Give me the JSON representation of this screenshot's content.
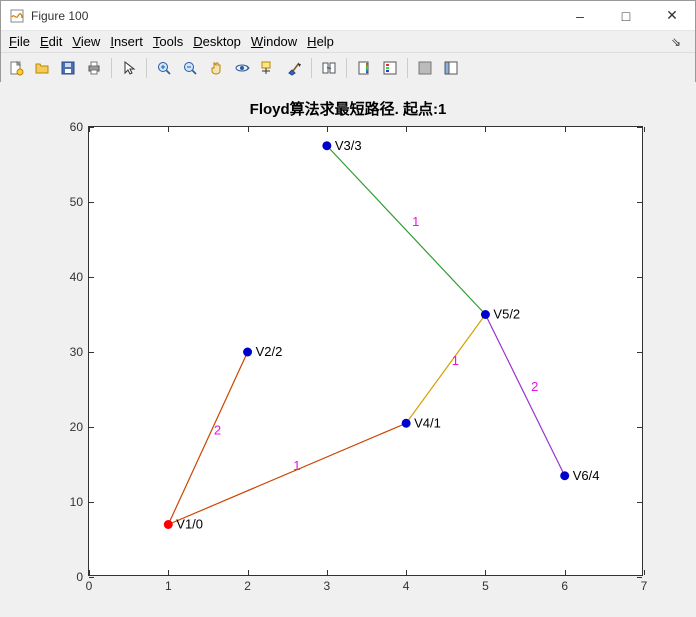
{
  "window": {
    "title": "Figure 100"
  },
  "menu": {
    "file": "File",
    "edit": "Edit",
    "view": "View",
    "insert": "Insert",
    "tools": "Tools",
    "desktop": "Desktop",
    "window": "Window",
    "help": "Help"
  },
  "toolbar_icons": {
    "new": "new-file-icon",
    "open": "open-folder-icon",
    "save": "save-icon",
    "print": "print-icon",
    "pointer": "pointer-icon",
    "zoom_in": "zoom-in-icon",
    "zoom_out": "zoom-out-icon",
    "pan": "pan-icon",
    "rotate": "rotate-3d-icon",
    "datatip": "data-cursor-icon",
    "brush": "brush-icon",
    "link": "link-plot-icon",
    "colorbar": "colorbar-icon",
    "legend": "legend-icon",
    "hide": "hide-plot-icon",
    "dock": "dock-icon"
  },
  "chart_data": {
    "type": "scatter",
    "title": "Floyd算法求最短路径. 起点:1",
    "xlim": [
      0,
      7
    ],
    "ylim": [
      0,
      60
    ],
    "xticks": [
      0,
      1,
      2,
      3,
      4,
      5,
      6,
      7
    ],
    "yticks": [
      0,
      10,
      20,
      30,
      40,
      50,
      60
    ],
    "nodes": [
      {
        "id": "V1",
        "x": 1,
        "y": 7,
        "label": "V1/0",
        "color": "#ff0000"
      },
      {
        "id": "V2",
        "x": 2,
        "y": 30,
        "label": "V2/2",
        "color": "#0000cc"
      },
      {
        "id": "V3",
        "x": 3,
        "y": 57.5,
        "label": "V3/3",
        "color": "#0000cc"
      },
      {
        "id": "V4",
        "x": 4,
        "y": 20.5,
        "label": "V4/1",
        "color": "#0000cc"
      },
      {
        "id": "V5",
        "x": 5,
        "y": 35,
        "label": "V5/2",
        "color": "#0000cc"
      },
      {
        "id": "V6",
        "x": 6,
        "y": 13.5,
        "label": "V6/4",
        "color": "#0000cc"
      }
    ],
    "edges": [
      {
        "from": "V1",
        "to": "V2",
        "weight": "2",
        "color": "#cc4400"
      },
      {
        "from": "V1",
        "to": "V4",
        "weight": "1",
        "color": "#cc4400"
      },
      {
        "from": "V4",
        "to": "V5",
        "weight": "1",
        "color": "#d4a000"
      },
      {
        "from": "V5",
        "to": "V3",
        "weight": "1",
        "color": "#339933"
      },
      {
        "from": "V5",
        "to": "V6",
        "weight": "2",
        "color": "#9933cc"
      }
    ]
  }
}
